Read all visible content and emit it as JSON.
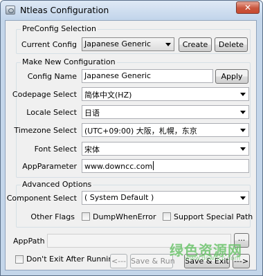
{
  "window": {
    "title": "Ntleas Configuration",
    "close_glyph": "✕"
  },
  "preconfig": {
    "legend": "PreConfig Selection",
    "current_label": "Current Config",
    "current_value": "Japanese Generic",
    "create_label": "Create",
    "delete_label": "Delete"
  },
  "new_config": {
    "legend": "Make New Configuration",
    "name_label": "Config Name",
    "name_value": "Japanese Generic",
    "apply_label": "Apply",
    "codepage_label": "Codepage Select",
    "codepage_value": "简体中文(HZ)",
    "locale_label": "Locale Select",
    "locale_value": "日语",
    "timezone_label": "Timezone Select",
    "timezone_value": "(UTC+09:00) 大阪，札幌，东京",
    "font_label": "Font Select",
    "font_value": "宋体",
    "appparam_label": "AppParameter",
    "appparam_value": "www.downcc.com"
  },
  "advanced": {
    "legend": "Advanced Options",
    "component_label": "Component Select",
    "component_value": "( System Default )",
    "flags_label": "Other Flags",
    "dump_label": "DumpWhenError",
    "special_path_label": "Support Special Path"
  },
  "bottom": {
    "apppath_label": "AppPath",
    "apppath_value": "",
    "browse_label": "...",
    "dont_exit_label": "Don't Exit After Running",
    "prev_label": "<---",
    "save_run_label": "Save & Run",
    "save_exit_label": "Save & Exit",
    "next_label": "--->"
  },
  "watermark": {
    "text": "绿色资源网",
    "url": "www.downcc.com"
  }
}
